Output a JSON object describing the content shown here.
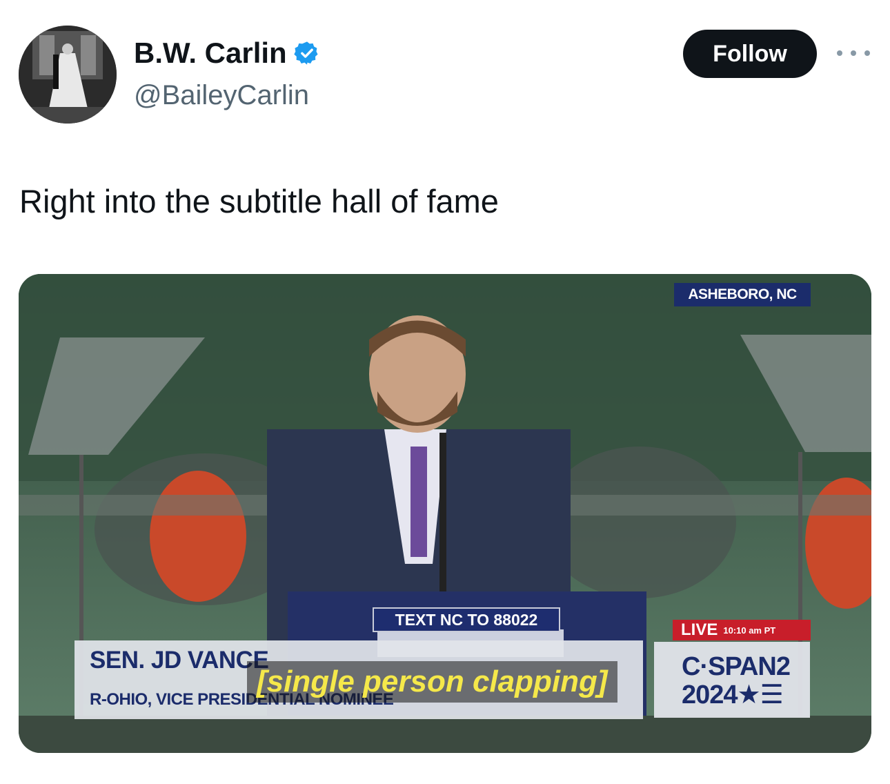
{
  "author": {
    "name": "B.W. Carlin",
    "handle": "@BaileyCarlin",
    "verified_icon": "verified-badge-icon",
    "accent_color": "#1d9bf0"
  },
  "actions": {
    "follow_label": "Follow",
    "more_icon": "more-options-icon"
  },
  "tweet": {
    "text": "Right into the subtitle hall of fame"
  },
  "media": {
    "location_tag": "ASHEBORO, NC",
    "lower_third_name": "SEN. JD VANCE",
    "lower_third_title": "R-OHIO, VICE PRESIDENTIAL NOMINEE",
    "subtitle": "[single person clapping]",
    "podium_sign": "TEXT NC TO 88022",
    "live_label": "LIVE",
    "live_time": "10:10 am PT",
    "network": "C·SPAN2",
    "network_year": "2024★☰"
  }
}
